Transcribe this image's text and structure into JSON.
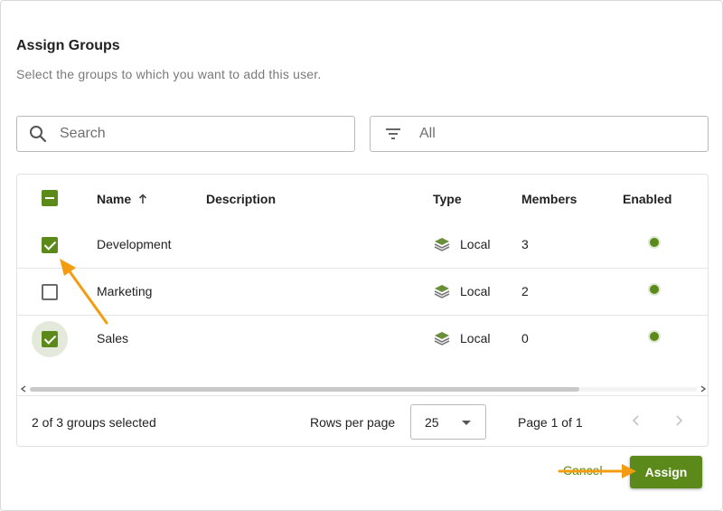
{
  "dialog": {
    "title": "Assign Groups",
    "subtitle": "Select the groups to which you want to add this user."
  },
  "search": {
    "placeholder": "Search",
    "value": "",
    "icon": "search-icon"
  },
  "filter": {
    "value": "All",
    "icon": "filter-icon"
  },
  "table": {
    "columns": {
      "name": "Name",
      "description": "Description",
      "type": "Type",
      "members": "Members",
      "enabled": "Enabled"
    },
    "sort": {
      "column": "name",
      "direction": "ascending",
      "icon": "sort-up-arrow-icon"
    },
    "header_checkbox": "indeterminate",
    "rows": [
      {
        "name": "Development",
        "description": "",
        "type": "Local",
        "members": "3",
        "enabled": true,
        "selected": true
      },
      {
        "name": "Marketing",
        "description": "",
        "type": "Local",
        "members": "2",
        "enabled": true,
        "selected": false
      },
      {
        "name": "Sales",
        "description": "",
        "type": "Local",
        "members": "0",
        "enabled": true,
        "selected": true
      }
    ]
  },
  "footer": {
    "selection_text": "2 of 3 groups selected",
    "rows_per_page_label": "Rows per page",
    "rows_per_page_value": "25",
    "page_text": "Page 1 of 1"
  },
  "actions": {
    "cancel_label": "Cancel",
    "assign_label": "Assign"
  },
  "colors": {
    "accent": "#5c8a1a",
    "annotation_arrow": "#f39c12"
  }
}
